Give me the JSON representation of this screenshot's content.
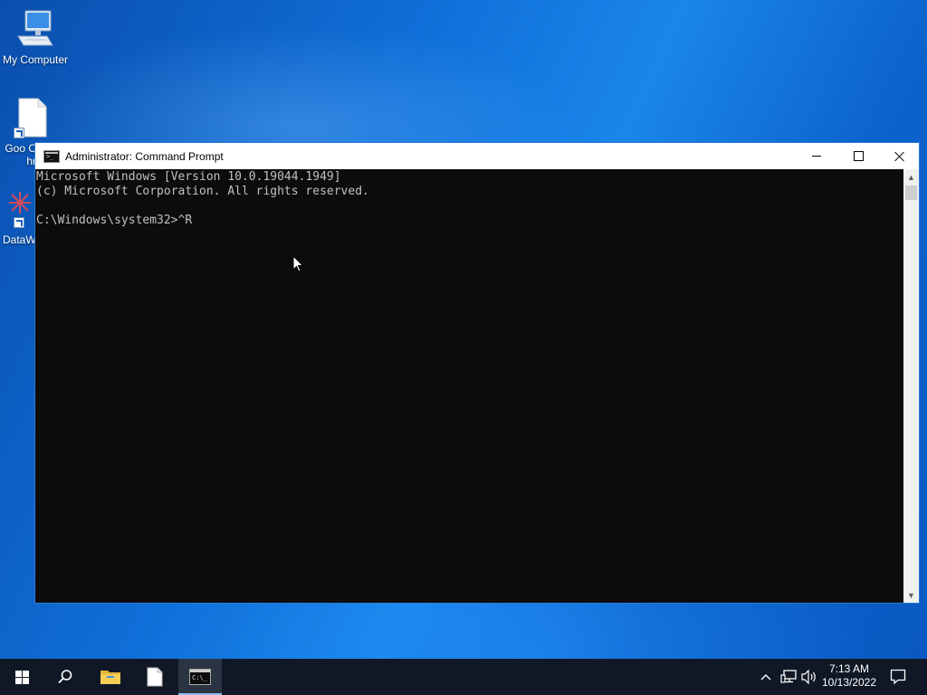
{
  "desktop": {
    "icons": [
      {
        "label": "My Computer"
      },
      {
        "label": "Goo Chr"
      },
      {
        "label": "DataW"
      }
    ]
  },
  "window": {
    "title": "Administrator: Command Prompt",
    "console_lines": [
      "Microsoft Windows [Version 10.0.19044.1949]",
      "(c) Microsoft Corporation. All rights reserved.",
      "",
      "C:\\Windows\\system32>^R"
    ]
  },
  "taskbar": {
    "clock_time": "7:13 AM",
    "clock_date": "10/13/2022"
  },
  "colors": {
    "console_bg": "#0c0c0c",
    "console_fg": "#c0c0c0",
    "taskbar_bg": "#101826"
  }
}
